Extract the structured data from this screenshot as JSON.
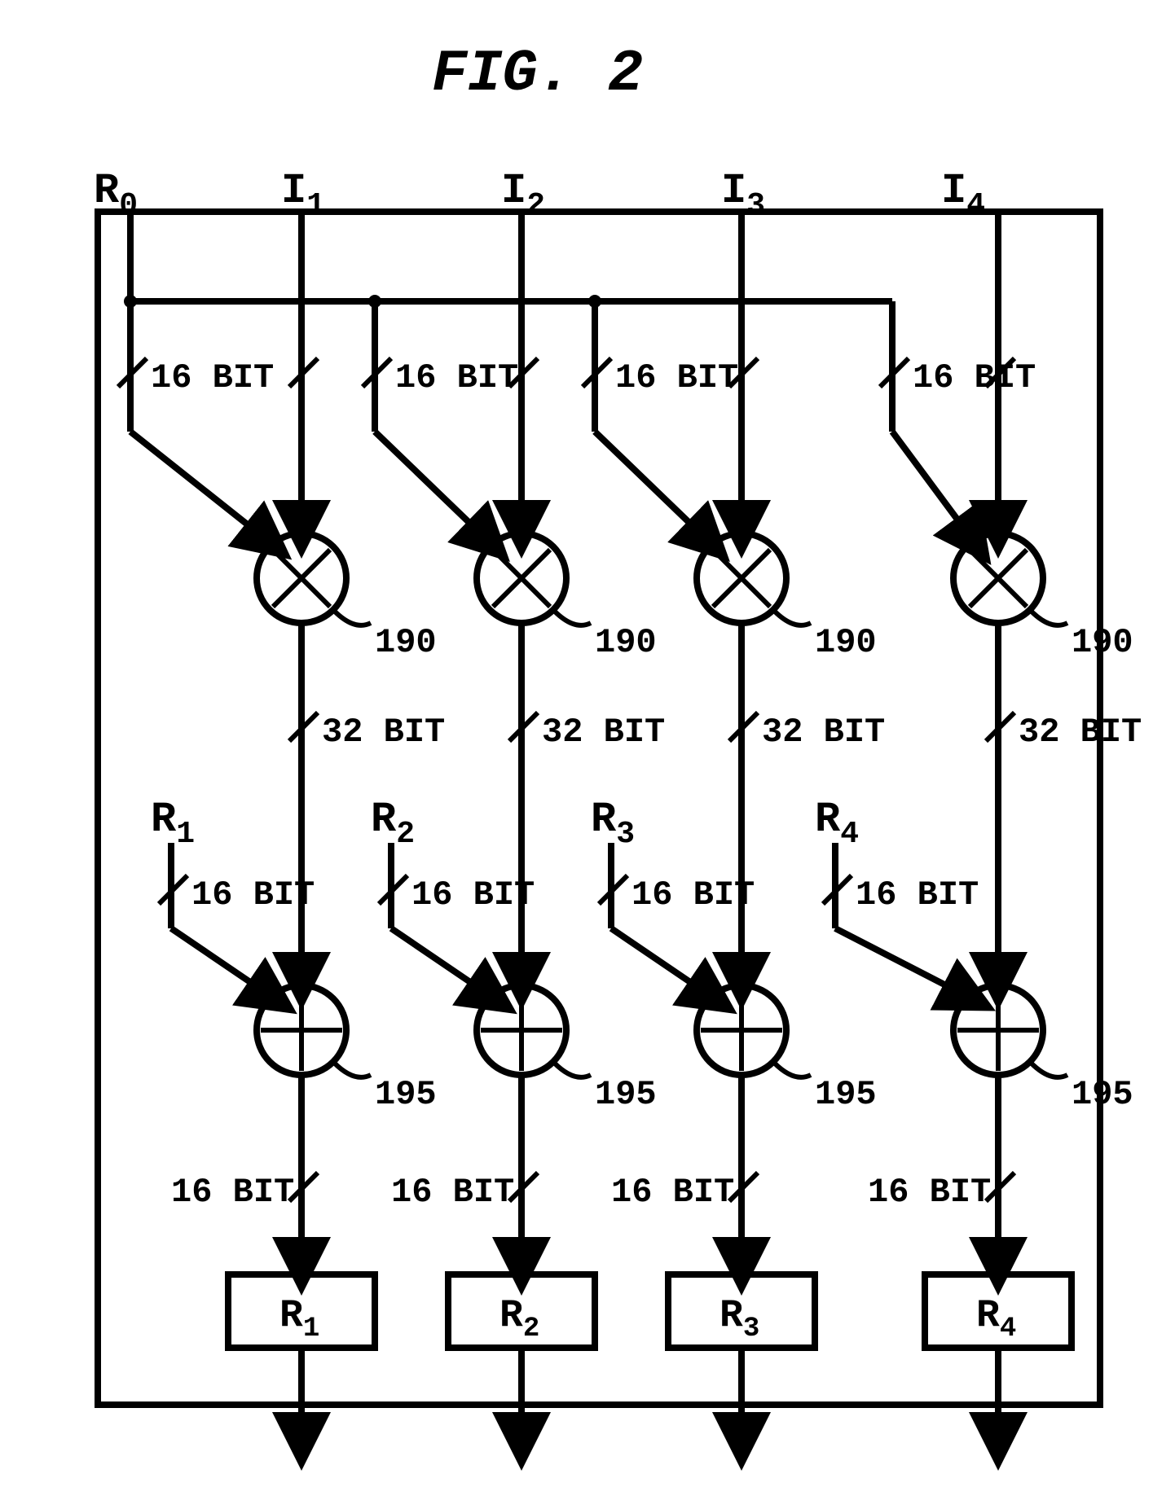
{
  "figure_title": "FIG. 2",
  "inputs": {
    "R0": "R",
    "R0_sub": "0",
    "I1": "I",
    "I1_sub": "1",
    "I2": "I",
    "I2_sub": "2",
    "I3": "I",
    "I3_sub": "3",
    "I4": "I",
    "I4_sub": "4"
  },
  "mid_inputs": {
    "R1": "R",
    "R1_sub": "1",
    "R2": "R",
    "R2_sub": "2",
    "R3": "R",
    "R3_sub": "3",
    "R4": "R",
    "R4_sub": "4"
  },
  "bit_labels": {
    "b16": "16 BIT",
    "b32": "32 BIT"
  },
  "ref_numbers": {
    "mult": "190",
    "add": "195"
  },
  "out_regs": {
    "R1": "R",
    "R1_sub": "1",
    "R2": "R",
    "R2_sub": "2",
    "R3": "R",
    "R3_sub": "3",
    "R4": "R",
    "R4_sub": "4"
  }
}
